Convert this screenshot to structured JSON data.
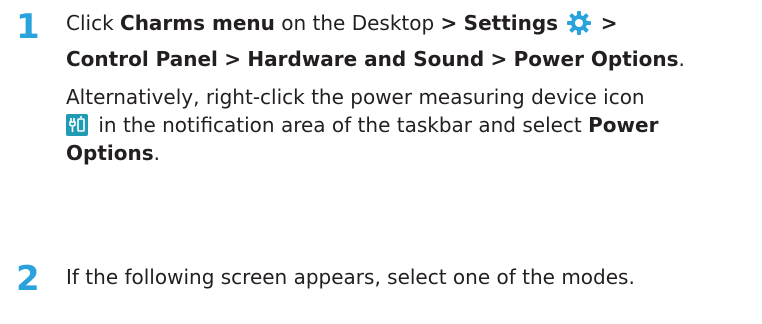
{
  "step1": {
    "number": "1",
    "p1": "Click ",
    "charms": "Charms menu",
    "p2": " on the Desktop ",
    "gt": ">",
    "settings": "Settings",
    "line2_a": "Control Panel",
    "line2_b": "Hardware and Sound",
    "line2_c": "Power Options",
    "period": ".",
    "alt1": "Alternatively, right-click the power measuring device icon",
    "alt2": " in the notification area of the taskbar and select ",
    "alt2_b": "Power",
    "alt3_b": "Options",
    "alt3": "."
  },
  "step2": {
    "number": "2",
    "text": "If the following screen appears, select one of the modes."
  },
  "colors": {
    "accent": "#2aa3dd",
    "text": "#231f20",
    "icon_bg": "#1f9cb3"
  },
  "icons": [
    "settings-gear-icon",
    "power-device-icon"
  ]
}
